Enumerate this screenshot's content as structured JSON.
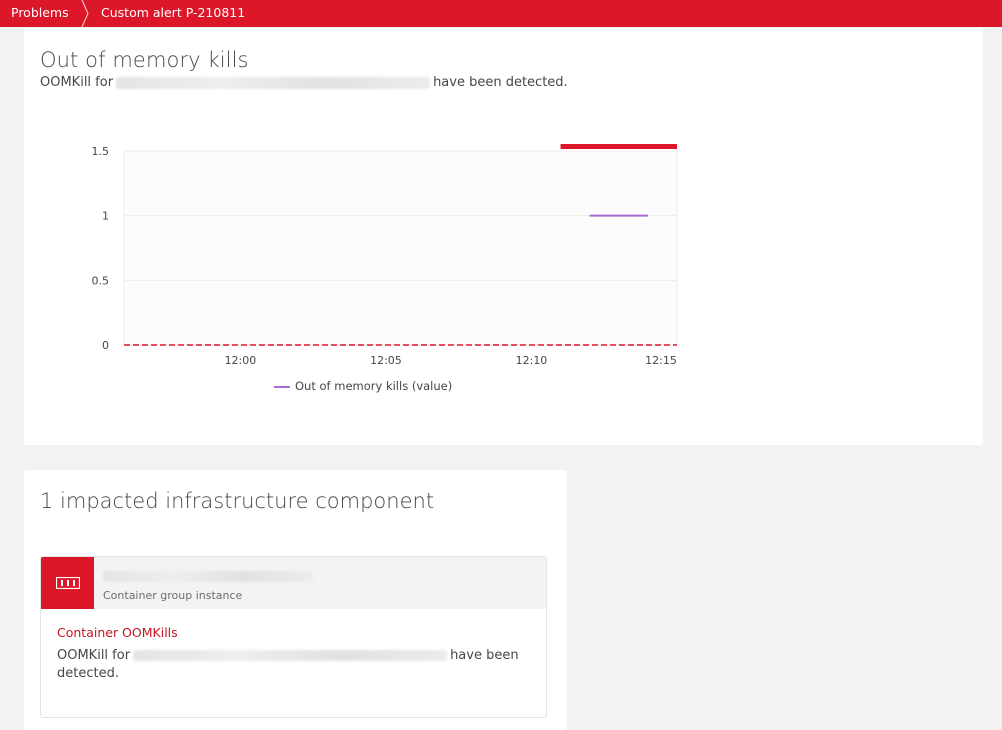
{
  "breadcrumb": {
    "items": [
      "Problems",
      "Custom alert P-210811"
    ]
  },
  "chart_card": {
    "title": "Out of memory kills",
    "description_prefix": "OOMKill for",
    "description_suffix": "have been detected."
  },
  "chart_data": {
    "type": "line",
    "title": "Out of memory kills",
    "xlabel": "",
    "ylabel": "",
    "x_ticks": [
      "12:00",
      "12:05",
      "12:10",
      "12:15"
    ],
    "y_ticks": [
      "0",
      "0.5",
      "1",
      "1.5"
    ],
    "ylim": [
      0,
      1.5
    ],
    "xlim": [
      "11:56",
      "12:15"
    ],
    "grid": true,
    "legend_position": "bottom",
    "series": [
      {
        "name": "Out of memory kills (value)",
        "color": "#a86bd6",
        "points": [
          {
            "x": "12:12",
            "y": 1
          },
          {
            "x": "12:14",
            "y": 1
          }
        ]
      }
    ],
    "threshold": {
      "y": 0,
      "color": "#dc172a",
      "style": "dashed"
    },
    "problem_marker": {
      "from": "12:11",
      "to": "12:15",
      "color": "#dc172a"
    }
  },
  "infra_card": {
    "title": "1 impacted infrastructure component",
    "component": {
      "icon": "container-group-icon",
      "type_label": "Container group instance"
    },
    "event": {
      "title": "Container OOMKills",
      "description_prefix": "OOMKill for",
      "description_suffix": "have been detected."
    }
  },
  "colors": {
    "brand_red": "#dc172a",
    "series_purple": "#a86bd6",
    "text": "#454646"
  }
}
